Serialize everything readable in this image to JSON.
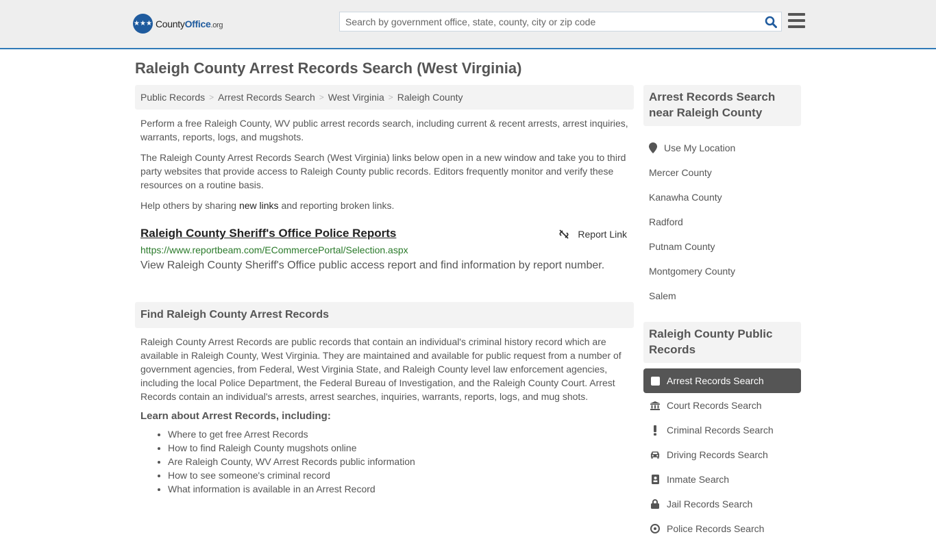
{
  "header": {
    "logo": {
      "part1": "County",
      "part2": "Office",
      "part3": ".org"
    },
    "search_placeholder": "Search by government office, state, county, city or zip code",
    "search_icon": "search-icon",
    "menu_icon": "hamburger-menu-icon",
    "accent_color": "#2f7ab8"
  },
  "page": {
    "title": "Raleigh County Arrest Records Search (West Virginia)"
  },
  "breadcrumb": [
    {
      "label": "Public Records"
    },
    {
      "label": "Arrest Records Search"
    },
    {
      "label": "West Virginia"
    },
    {
      "label": "Raleigh County"
    }
  ],
  "intro": {
    "p1": "Perform a free Raleigh County, WV public arrest records search, including current & recent arrests, arrest inquiries, warrants, reports, logs, and mugshots.",
    "p2": "The Raleigh County Arrest Records Search (West Virginia) links below open in a new window and take you to third party websites that provide access to Raleigh County public records. Editors frequently monitor and verify these resources on a routine basis.",
    "p3_before": "Help others by sharing ",
    "p3_link": "new links",
    "p3_after": " and reporting broken links."
  },
  "results": [
    {
      "title": "Raleigh County Sheriff's Office Police Reports",
      "report_label": "Report Link",
      "url": "https://www.reportbeam.com/ECommercePortal/Selection.aspx",
      "description": "View Raleigh County Sheriff's Office public access report and find information by report number."
    }
  ],
  "find_section": {
    "heading": "Find Raleigh County Arrest Records",
    "body": "Raleigh County Arrest Records are public records that contain an individual's criminal history record which are available in Raleigh County, West Virginia. They are maintained and available for public request from a number of government agencies, from Federal, West Virginia State, and Raleigh County level law enforcement agencies, including the local Police Department, the Federal Bureau of Investigation, and the Raleigh County Court. Arrest Records contain an individual's arrests, arrest searches, inquiries, warrants, reports, logs, and mug shots.",
    "learn_heading": "Learn about Arrest Records, including:",
    "learn_items": [
      "Where to get free Arrest Records",
      "How to find Raleigh County mugshots online",
      "Are Raleigh County, WV Arrest Records public information",
      "How to see someone's criminal record",
      "What information is available in an Arrest Record"
    ]
  },
  "sidebar": {
    "near_heading": "Arrest Records Search near Raleigh County",
    "use_location": "Use My Location",
    "near_items": [
      "Mercer County",
      "Kanawha County",
      "Radford",
      "Putnam County",
      "Montgomery County",
      "Salem"
    ],
    "records_heading": "Raleigh County Public Records",
    "records_items": [
      {
        "label": "Arrest Records Search",
        "icon": "square-icon",
        "active": true
      },
      {
        "label": "Court Records Search",
        "icon": "courthouse-icon",
        "active": false
      },
      {
        "label": "Criminal Records Search",
        "icon": "exclamation-icon",
        "active": false
      },
      {
        "label": "Driving Records Search",
        "icon": "car-icon",
        "active": false
      },
      {
        "label": "Inmate Search",
        "icon": "id-badge-icon",
        "active": false
      },
      {
        "label": "Jail Records Search",
        "icon": "lock-icon",
        "active": false
      },
      {
        "label": "Police Records Search",
        "icon": "police-badge-icon",
        "active": false
      }
    ]
  }
}
